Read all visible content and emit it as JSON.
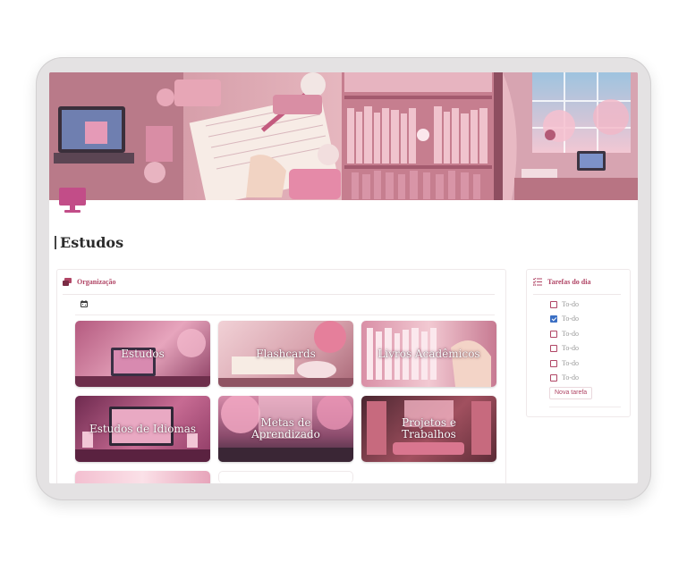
{
  "page": {
    "title": "Estudos",
    "cover_icon": "desktop-monitor-icon",
    "accent_color": "#b04565"
  },
  "organizacao": {
    "label": "Organização",
    "icon": "cards-stack-icon",
    "calendar_icon": "calendar-icon",
    "cards": [
      {
        "title": "Estudos"
      },
      {
        "title": "Flashcards"
      },
      {
        "title": "Livros Acadêmicos"
      },
      {
        "title": "Estudos de Idiomas"
      },
      {
        "title": "Metas de Aprendizado"
      },
      {
        "title": "Projetos e Trabalhos"
      }
    ]
  },
  "tarefas": {
    "label": "Tarefas do dia",
    "icon": "checklist-icon",
    "items": [
      {
        "text": "To-do",
        "checked": false
      },
      {
        "text": "To-do",
        "checked": true
      },
      {
        "text": "To-do",
        "checked": false
      },
      {
        "text": "To-do",
        "checked": false
      },
      {
        "text": "To-do",
        "checked": false
      },
      {
        "text": "To-do",
        "checked": false
      }
    ],
    "new_task_label": "Nova tarefa"
  }
}
